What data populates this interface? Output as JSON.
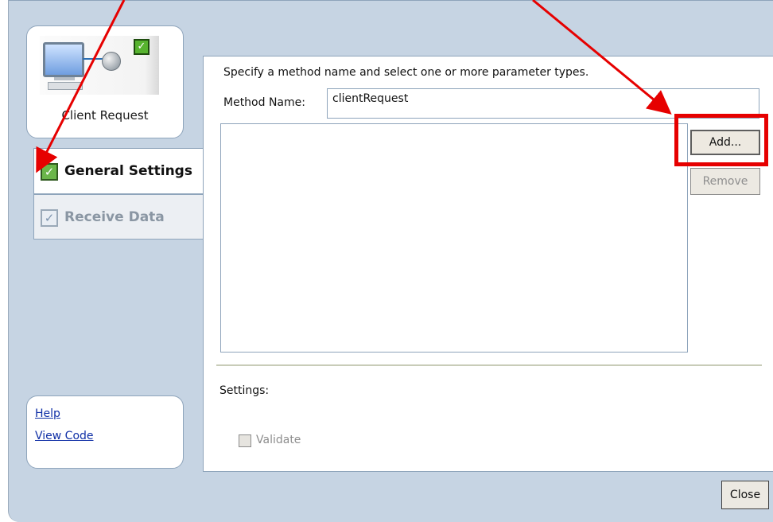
{
  "step": {
    "label": "Client Request"
  },
  "nav": {
    "general": "General Settings",
    "receive": "Receive Data"
  },
  "links": {
    "help": "Help",
    "view_code": "View Code"
  },
  "content": {
    "instruction": "Specify a method name and select one or more parameter types.",
    "method_label": "Method Name:",
    "method_value": "clientRequest",
    "add_label": "Add...",
    "remove_label": "Remove",
    "settings_label": "Settings:",
    "validate_label": "Validate"
  },
  "footer": {
    "close_label": "Close"
  },
  "colors": {
    "annotation_red": "#e60000",
    "frame_blue": "#c6d4e3",
    "border": "#8ea4bb",
    "check_green": "#57b32f"
  }
}
